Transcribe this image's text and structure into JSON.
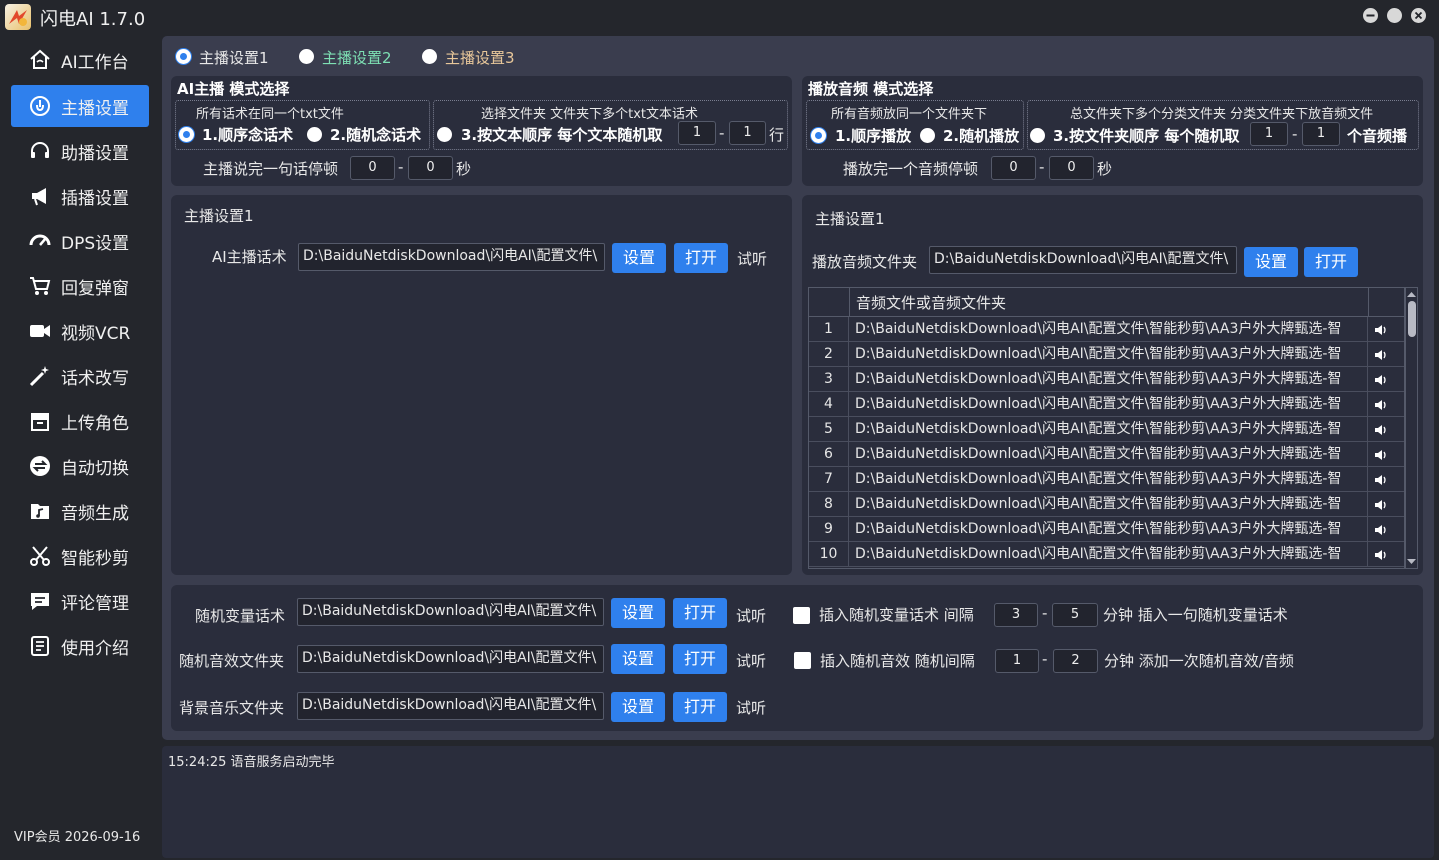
{
  "app": {
    "title": "闪电AI 1.7.0"
  },
  "sidebar": {
    "items": [
      {
        "label": "AI工作台",
        "icon": "home-icon"
      },
      {
        "label": "主播设置",
        "icon": "anchor-icon",
        "active": true
      },
      {
        "label": "助播设置",
        "icon": "headset-icon"
      },
      {
        "label": "插播设置",
        "icon": "megaphone-icon"
      },
      {
        "label": "DPS设置",
        "icon": "gauge-icon"
      },
      {
        "label": "回复弹窗",
        "icon": "cart-icon"
      },
      {
        "label": "视频VCR",
        "icon": "video-camera-icon"
      },
      {
        "label": "话术改写",
        "icon": "magic-wand-icon"
      },
      {
        "label": "上传角色",
        "icon": "archive-box-icon"
      },
      {
        "label": "自动切换",
        "icon": "switch-icon"
      },
      {
        "label": "音频生成",
        "icon": "music-folder-icon"
      },
      {
        "label": "智能秒剪",
        "icon": "scissors-icon"
      },
      {
        "label": "评论管理",
        "icon": "comment-icon"
      },
      {
        "label": "使用介绍",
        "icon": "document-icon"
      }
    ],
    "vip": "VIP会员 2026-09-16"
  },
  "tabs": [
    {
      "label": "主播设置1",
      "color": "#ffffff",
      "selected": true
    },
    {
      "label": "主播设置2",
      "color": "#7ee0b4",
      "selected": false
    },
    {
      "label": "主播设置3",
      "color": "#e8c79a",
      "selected": false
    }
  ],
  "ai_mode": {
    "title": "AI主播 模式选择",
    "group1_label": "所有话术在同一个txt文件",
    "opt1": "1.顺序念话术",
    "opt2": "2.随机念话术",
    "group2_label": "选择文件夹 文件夹下多个txt文本话术",
    "opt3": "3.按文本顺序 每个文本随机取",
    "from": "1",
    "to": "1",
    "unit": "行",
    "pause_label": "主播说完一句话停顿",
    "pause_from": "0",
    "pause_to": "0",
    "pause_unit": "秒",
    "dash": "-"
  },
  "audio_mode": {
    "title": "播放音频 模式选择",
    "group1_label": "所有音频放同一个文件夹下",
    "opt1": "1.顺序播放",
    "opt2": "2.随机播放",
    "group2_label": "总文件夹下多个分类文件夹 分类文件夹下放音频文件",
    "opt3": "3.按文件夹顺序 每个随机取",
    "from": "1",
    "to": "1",
    "unit": "个音频播",
    "pause_label": "播放完一个音频停顿",
    "pause_from": "0",
    "pause_to": "0",
    "pause_unit": "秒"
  },
  "left_panel": {
    "title": "主播设置1",
    "field_label": "AI主播话术",
    "path": "D:\\BaiduNetdiskDownload\\闪电AI\\配置文件\\",
    "set": "设置",
    "open": "打开",
    "listen": "试听"
  },
  "right_panel": {
    "title": "主播设置1",
    "field_label": "播放音频文件夹",
    "path": "D:\\BaiduNetdiskDownload\\闪电AI\\配置文件\\",
    "set": "设置",
    "open": "打开",
    "table_header": "音频文件或音频文件夹",
    "rows": [
      {
        "n": "1",
        "path": "D:\\BaiduNetdiskDownload\\闪电AI\\配置文件\\智能秒剪\\AA3户外大牌甄选-智"
      },
      {
        "n": "2",
        "path": "D:\\BaiduNetdiskDownload\\闪电AI\\配置文件\\智能秒剪\\AA3户外大牌甄选-智"
      },
      {
        "n": "3",
        "path": "D:\\BaiduNetdiskDownload\\闪电AI\\配置文件\\智能秒剪\\AA3户外大牌甄选-智"
      },
      {
        "n": "4",
        "path": "D:\\BaiduNetdiskDownload\\闪电AI\\配置文件\\智能秒剪\\AA3户外大牌甄选-智"
      },
      {
        "n": "5",
        "path": "D:\\BaiduNetdiskDownload\\闪电AI\\配置文件\\智能秒剪\\AA3户外大牌甄选-智"
      },
      {
        "n": "6",
        "path": "D:\\BaiduNetdiskDownload\\闪电AI\\配置文件\\智能秒剪\\AA3户外大牌甄选-智"
      },
      {
        "n": "7",
        "path": "D:\\BaiduNetdiskDownload\\闪电AI\\配置文件\\智能秒剪\\AA3户外大牌甄选-智"
      },
      {
        "n": "8",
        "path": "D:\\BaiduNetdiskDownload\\闪电AI\\配置文件\\智能秒剪\\AA3户外大牌甄选-智"
      },
      {
        "n": "9",
        "path": "D:\\BaiduNetdiskDownload\\闪电AI\\配置文件\\智能秒剪\\AA3户外大牌甄选-智"
      },
      {
        "n": "10",
        "path": "D:\\BaiduNetdiskDownload\\闪电AI\\配置文件\\智能秒剪\\AA3户外大牌甄选-智"
      }
    ]
  },
  "bottom": {
    "rows": [
      {
        "label": "随机变量话术",
        "path": "D:\\BaiduNetdiskDownload\\闪电AI\\配置文件\\",
        "set": "设置",
        "open": "打开",
        "listen": "试听"
      },
      {
        "label": "随机音效文件夹",
        "path": "D:\\BaiduNetdiskDownload\\闪电AI\\配置文件\\",
        "set": "设置",
        "open": "打开",
        "listen": "试听"
      },
      {
        "label": "背景音乐文件夹",
        "path": "D:\\BaiduNetdiskDownload\\闪电AI\\配置文件\\",
        "set": "设置",
        "open": "打开",
        "listen": "试听"
      }
    ],
    "insert1": {
      "label": "插入随机变量话术 间隔",
      "from": "3",
      "to": "5",
      "suffix": "分钟 插入一句随机变量话术"
    },
    "insert2": {
      "label": "插入随机音效 随机间隔",
      "from": "1",
      "to": "2",
      "suffix": "分钟 添加一次随机音效/音频"
    }
  },
  "log": {
    "line": "15:24:25 语音服务启动完毕"
  },
  "colors": {
    "accent": "#2f80ed",
    "panel": "#2a2d3c",
    "bg": "#24262c"
  }
}
